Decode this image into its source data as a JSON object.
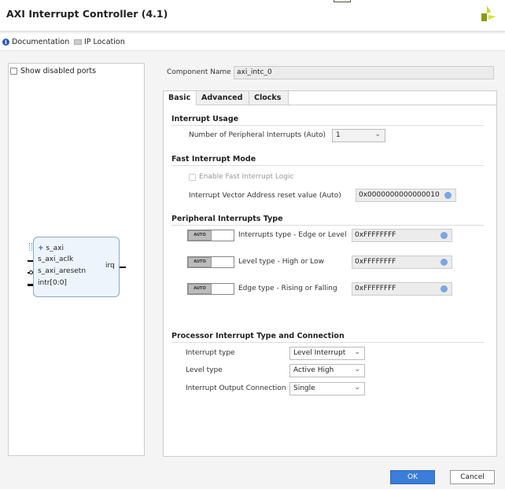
{
  "window": {
    "title": "AXI Interrupt Controller (4.1)"
  },
  "toolbar": {
    "documentation": "Documentation",
    "ip_location": "IP Location"
  },
  "left_panel": {
    "show_disabled_ports": "Show disabled ports",
    "block": {
      "ports_left": [
        "s_axi",
        "s_axi_aclk",
        "s_axi_aresetn",
        "intr[0:0]"
      ],
      "port_right": "irq"
    }
  },
  "component": {
    "label": "Component Name",
    "value": "axi_intc_0"
  },
  "tabs": [
    {
      "label": "Basic",
      "active": true
    },
    {
      "label": "Advanced"
    },
    {
      "label": "Clocks"
    }
  ],
  "basic": {
    "interrupt_usage": {
      "title": "Interrupt Usage",
      "num_label": "Number of Peripheral Interrupts (Auto)",
      "num_value": "1"
    },
    "fast_mode": {
      "title": "Fast Interrupt Mode",
      "enable_label": "Enable Fast Interrupt Logic",
      "enable_checked": false,
      "vector_label": "Interrupt Vector Address reset value (Auto)",
      "vector_value": "0x0000000000000010"
    },
    "peripheral": {
      "title": "Peripheral Interrupts Type",
      "toggle_label": "AUTO",
      "rows": [
        {
          "label": "Interrupts type - Edge or Level",
          "value": "0xFFFFFFFF"
        },
        {
          "label": "Level type - High or Low",
          "value": "0xFFFFFFFF"
        },
        {
          "label": "Edge type - Rising or Falling",
          "value": "0xFFFFFFFF"
        }
      ]
    },
    "processor": {
      "title": "Processor Interrupt Type and Connection",
      "rows": [
        {
          "label": "Interrupt type",
          "value": "Level Interrupt"
        },
        {
          "label": "Level type",
          "value": "Active High"
        },
        {
          "label": "Interrupt Output Connection",
          "value": "Single"
        }
      ]
    }
  },
  "buttons": {
    "ok": "OK",
    "cancel": "Cancel"
  },
  "colors": {
    "accent": "#3b7dd8",
    "logo": "#a8b820"
  }
}
